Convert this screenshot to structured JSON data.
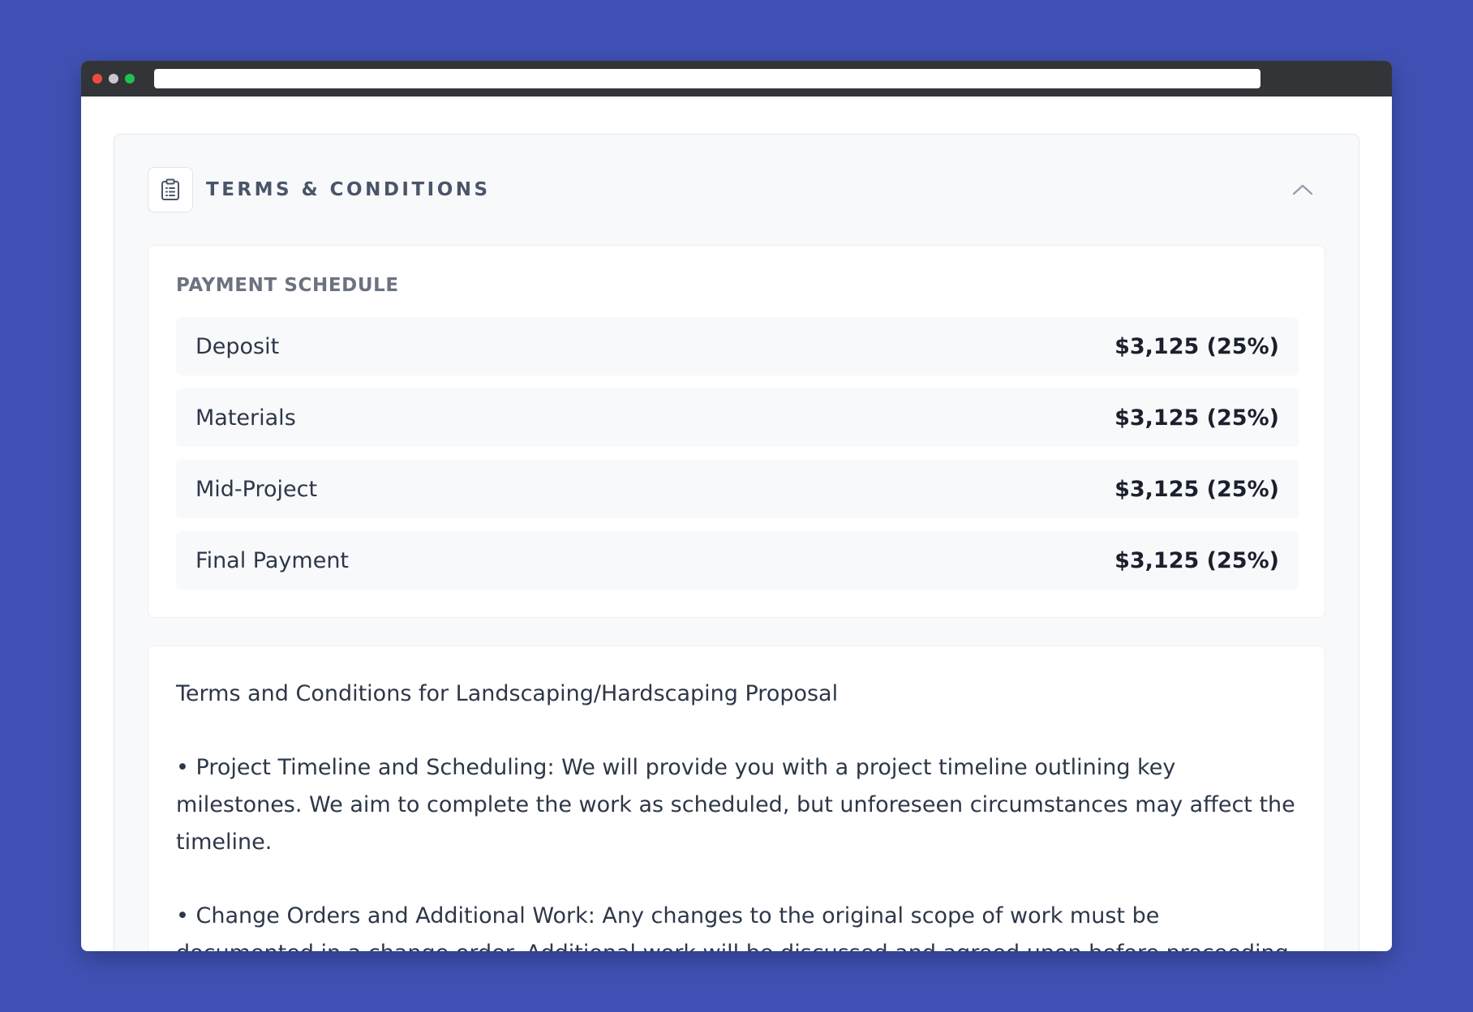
{
  "window": {
    "url": ""
  },
  "section": {
    "title": "TERMS & CONDITIONS",
    "icon": "clipboard-icon",
    "toggle_icon": "chevron-up-icon"
  },
  "payment_schedule": {
    "heading": "PAYMENT SCHEDULE",
    "rows": [
      {
        "label": "Deposit",
        "amount": "$3,125 (25%)"
      },
      {
        "label": "Materials",
        "amount": "$3,125 (25%)"
      },
      {
        "label": "Mid-Project",
        "amount": "$3,125 (25%)"
      },
      {
        "label": "Final Payment",
        "amount": "$3,125 (25%)"
      }
    ]
  },
  "terms": {
    "intro": "Terms and Conditions for Landscaping/Hardscaping Proposal",
    "items": [
      "• Project Timeline and Scheduling: We will provide you with a project timeline outlining key milestones. We aim to complete the work as scheduled, but unforeseen circumstances may affect the timeline.",
      "• Change Orders and Additional Work: Any changes to the original scope of work must be documented in a change order. Additional work will be discussed and agreed upon before proceeding."
    ]
  },
  "colors": {
    "background": "#3f51b5",
    "titlebar": "#323438",
    "card": "#f8f9fb"
  }
}
